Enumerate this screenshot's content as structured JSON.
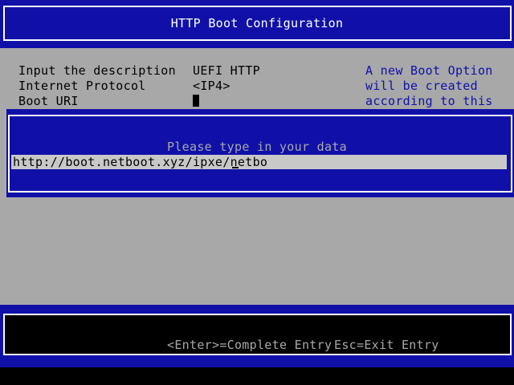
{
  "header": {
    "title": "HTTP Boot Configuration"
  },
  "form": {
    "fields": [
      {
        "label": "Input the description",
        "value": "UEFI HTTP"
      },
      {
        "label": "Internet Protocol",
        "value": "<IP4>"
      },
      {
        "label": "Boot URI",
        "value": ""
      }
    ],
    "help_lines": [
      "A new Boot Option",
      "will be created",
      "according to this"
    ]
  },
  "popup": {
    "prompt": "Please type in your data",
    "input_value": "http://boot.netboot.xyz/ipxe/netbo"
  },
  "footer": {
    "enter_hint": "<Enter>=Complete Entry",
    "esc_hint": "Esc=Exit Entry"
  },
  "colors": {
    "bios_blue": "#1010a8",
    "bios_gray": "#a8a8a8",
    "white": "#ffffff",
    "black": "#000000"
  }
}
